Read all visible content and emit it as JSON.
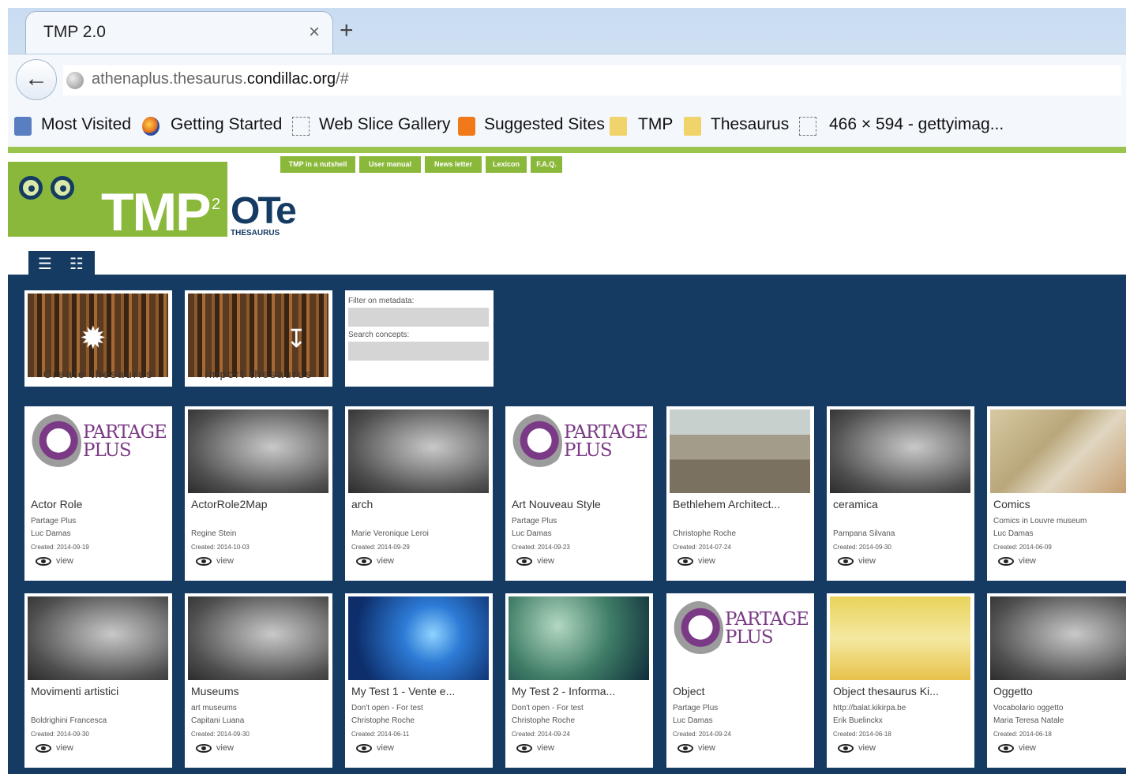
{
  "browser": {
    "tab_title": "TMP 2.0",
    "tab_close": "×",
    "new_tab": "+",
    "url_prefix": "athenaplus.thesaurus.",
    "url_domain": "condillac.org",
    "url_suffix": "/#",
    "bookmarks": [
      "Most Visited",
      "Getting Started",
      "Web Slice Gallery",
      "Suggested Sites",
      "TMP",
      "Thesaurus",
      "466 × 594 - gettyimag..."
    ]
  },
  "site": {
    "logo_text": "TMP",
    "logo_sup": "2",
    "ote_text": "OTe",
    "ote_sub": "THESAURUS",
    "menu": [
      "TMP in a nutshell",
      "User manual",
      "News letter",
      "Lexicon",
      "F.A.Q."
    ]
  },
  "tools": {
    "create_label": "Create thesaurus",
    "import_label": "Import thesaurus",
    "filter_label": "Filter on metadata:",
    "search_label": "Search concepts:"
  },
  "card_view_label": "view",
  "cards": [
    {
      "title": "Actor Role",
      "line1": "Partage Plus",
      "line2": "Luc Damas",
      "date": "Created: 2014-09-19",
      "image": "partage"
    },
    {
      "title": "ActorRole2Map",
      "line1": "",
      "line2": "Regine Stein",
      "date": "Created: 2014-10-03",
      "image": "gray"
    },
    {
      "title": "arch",
      "line1": "",
      "line2": "Marie Veronique Leroi",
      "date": "Created: 2014-09-29",
      "image": "gray"
    },
    {
      "title": "Art Nouveau Style",
      "line1": "Partage Plus",
      "line2": "Luc Damas",
      "date": "Created: 2014-09-23",
      "image": "partage"
    },
    {
      "title": "Bethlehem Architect...",
      "line1": "",
      "line2": "Christophe Roche",
      "date": "Created: 2014-07-24",
      "image": "city"
    },
    {
      "title": "ceramica",
      "line1": "",
      "line2": "Pampana Silvana",
      "date": "Created: 2014-09-30",
      "image": "gray"
    },
    {
      "title": "Comics",
      "line1": "Comics in Louvre museum",
      "line2": "Luc Damas",
      "date": "Created: 2014-06-09",
      "image": "comics"
    },
    {
      "title": "Movimenti artistici",
      "line1": "",
      "line2": "Boldrighini Francesca",
      "date": "Created: 2014-09-30",
      "image": "gray"
    },
    {
      "title": "Museums",
      "line1": "art museums",
      "line2": "Capitani Luana",
      "date": "Created: 2014-09-30",
      "image": "gray"
    },
    {
      "title": "My Test 1 - Vente e...",
      "line1": "Don't open - For test",
      "line2": "Christophe Roche",
      "date": "Created: 2014-06-11",
      "image": "blue"
    },
    {
      "title": "My Test 2 - Informa...",
      "line1": "Don't open - For test",
      "line2": "Christophe Roche",
      "date": "Created: 2014-09-24",
      "image": "globe"
    },
    {
      "title": "Object",
      "line1": "Partage Plus",
      "line2": "Luc Damas",
      "date": "Created: 2014-09-24",
      "image": "partage"
    },
    {
      "title": "Object thesaurus Ki...",
      "line1": "http://balat.kikirpa.be",
      "line2": "Erik Buelinckx",
      "date": "Created: 2014-06-18",
      "image": "cartoon"
    },
    {
      "title": "Oggetto",
      "line1": "Vocabolario oggetto",
      "line2": "Maria Teresa Natale",
      "date": "Created: 2014-06-18",
      "image": "gray"
    }
  ],
  "partage_logo": {
    "line1": "PARTAGE",
    "line2": "PLUS"
  },
  "colors": {
    "navy": "#153b63",
    "green": "#8ab83a",
    "partage_purple": "#7b3a86"
  }
}
